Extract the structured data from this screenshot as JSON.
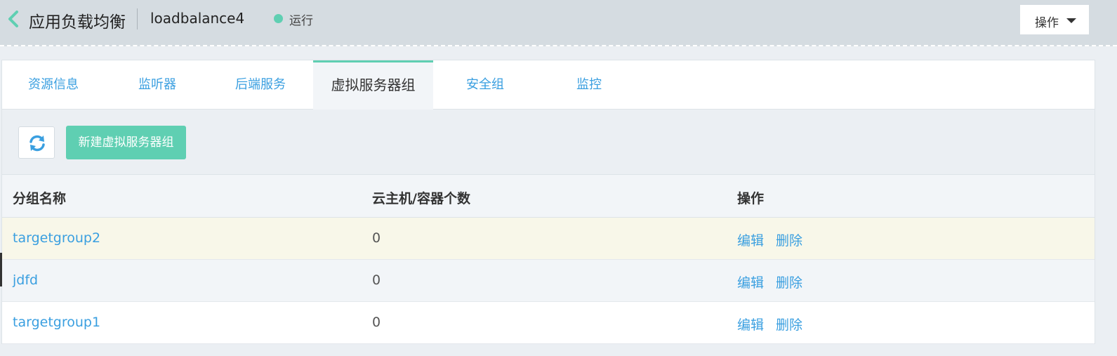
{
  "header": {
    "title": "应用负载均衡",
    "instance_name": "loadbalance4",
    "status": "运行",
    "status_color": "#5fcfb2",
    "ops_button_label": "操作"
  },
  "tabs": [
    {
      "label": "资源信息",
      "active": false
    },
    {
      "label": "监听器",
      "active": false
    },
    {
      "label": "后端服务",
      "active": false
    },
    {
      "label": "虚拟服务器组",
      "active": true
    },
    {
      "label": "安全组",
      "active": false
    },
    {
      "label": "监控",
      "active": false
    }
  ],
  "toolbar": {
    "refresh_icon": "refresh-icon",
    "create_label": "新建虚拟服务器组"
  },
  "table": {
    "headers": [
      "分组名称",
      "云主机/容器个数",
      "操作"
    ],
    "rows": [
      {
        "name": "targetgroup2",
        "count": "0",
        "edit": "编辑",
        "delete": "删除"
      },
      {
        "name": "jdfd",
        "count": "0",
        "edit": "编辑",
        "delete": "删除"
      },
      {
        "name": "targetgroup1",
        "count": "0",
        "edit": "编辑",
        "delete": "删除"
      }
    ]
  },
  "colors": {
    "accent": "#5fcfb2",
    "link": "#3a9fe0",
    "header_bg": "#d5dce1",
    "highlight_row": "#f8f7e9"
  }
}
